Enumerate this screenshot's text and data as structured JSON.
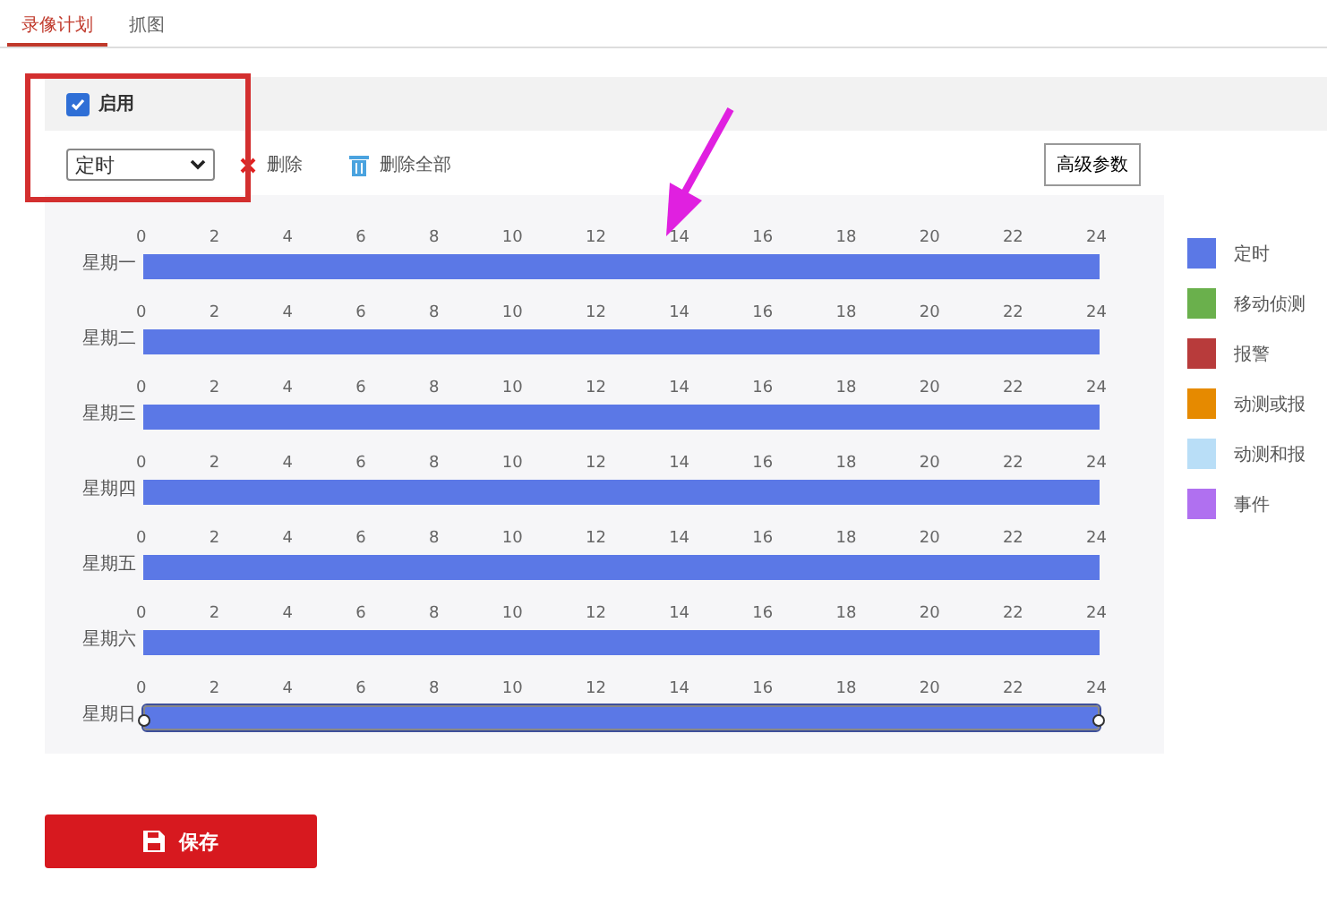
{
  "tabs": [
    {
      "label": "录像计划",
      "selected": true
    },
    {
      "label": "抓图",
      "selected": false
    }
  ],
  "enable": {
    "label": "启用",
    "checked": true
  },
  "toolbar": {
    "mode_select": {
      "value": "定时"
    },
    "delete": "删除",
    "delete_all": "删除全部",
    "advanced": "高级参数"
  },
  "days": [
    {
      "label": "星期一",
      "level": 1,
      "selected": false,
      "ticks": [
        "0",
        "2",
        "4",
        "6",
        "8",
        "10",
        "12",
        "14",
        "16",
        "18",
        "20",
        "22",
        "24"
      ]
    },
    {
      "label": "星期二",
      "level": 1,
      "selected": false,
      "ticks": [
        "0",
        "2",
        "4",
        "6",
        "8",
        "10",
        "12",
        "14",
        "16",
        "18",
        "20",
        "22",
        "24"
      ]
    },
    {
      "label": "星期三",
      "level": 1,
      "selected": false,
      "ticks": [
        "0",
        "2",
        "4",
        "6",
        "8",
        "10",
        "12",
        "14",
        "16",
        "18",
        "20",
        "22",
        "24"
      ]
    },
    {
      "label": "星期四",
      "level": 1,
      "selected": false,
      "ticks": [
        "0",
        "2",
        "4",
        "6",
        "8",
        "10",
        "12",
        "14",
        "16",
        "18",
        "20",
        "22",
        "24"
      ]
    },
    {
      "label": "星期五",
      "level": 1,
      "selected": false,
      "ticks": [
        "0",
        "2",
        "4",
        "6",
        "8",
        "10",
        "12",
        "14",
        "16",
        "18",
        "20",
        "22",
        "24"
      ]
    },
    {
      "label": "星期六",
      "level": 1,
      "selected": false,
      "ticks": [
        "0",
        "2",
        "4",
        "6",
        "8",
        "10",
        "12",
        "14",
        "16",
        "18",
        "20",
        "22",
        "24"
      ]
    },
    {
      "label": "星期日",
      "level": 1,
      "selected": true,
      "ticks": [
        "0",
        "2",
        "4",
        "6",
        "8",
        "10",
        "12",
        "14",
        "16",
        "18",
        "20",
        "22",
        "24"
      ]
    }
  ],
  "legend": [
    {
      "label": "定时",
      "color": "#5b78e6"
    },
    {
      "label": "移动侦测",
      "color": "#6ab04c"
    },
    {
      "label": "报警",
      "color": "#b83b3b"
    },
    {
      "label": "动测或报",
      "color": "#e68a00"
    },
    {
      "label": "动测和报",
      "color": "#b9def7"
    },
    {
      "label": "事件",
      "color": "#b070f0"
    }
  ],
  "save_button": "保存"
}
